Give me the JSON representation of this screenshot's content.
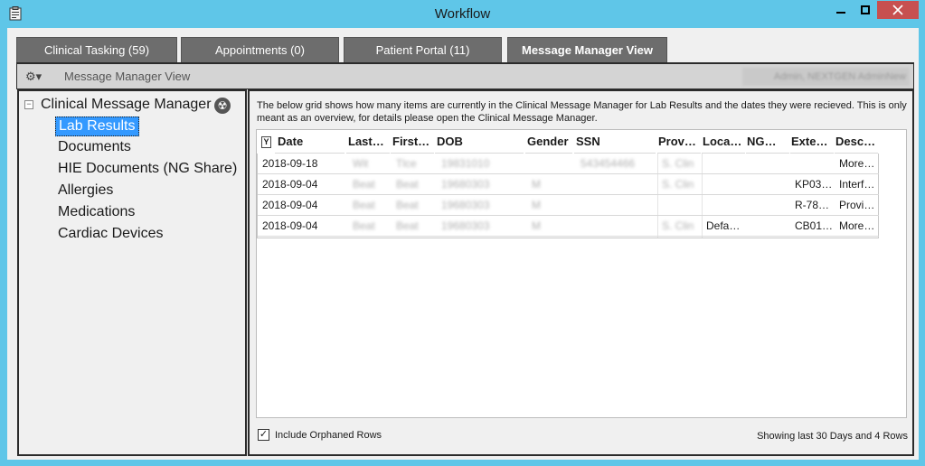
{
  "window": {
    "title": "Workflow",
    "app_icon": "clipboard-app-icon",
    "controls": {
      "minimize": "—",
      "maximize": "☐",
      "close": "✕"
    }
  },
  "tabs": [
    {
      "label": "Clinical Tasking (59)",
      "active": false
    },
    {
      "label": "Appointments (0)",
      "active": false
    },
    {
      "label": "Patient Portal (11)",
      "active": false
    },
    {
      "label": "Message Manager View",
      "active": true
    }
  ],
  "toolbar": {
    "gear_icon": "⚙▾",
    "title": "Message Manager View",
    "user": "Admin, NEXTGEN AdminNew"
  },
  "tree": {
    "root_label": "Clinical Message Manager",
    "expander": "−",
    "root_icon": "☢",
    "items": [
      {
        "label": "Lab Results",
        "selected": true
      },
      {
        "label": "Documents",
        "selected": false
      },
      {
        "label": "HIE Documents (NG Share)",
        "selected": false
      },
      {
        "label": "Allergies",
        "selected": false
      },
      {
        "label": "Medications",
        "selected": false
      },
      {
        "label": "Cardiac Devices",
        "selected": false
      }
    ]
  },
  "main": {
    "description": "The below grid shows how many items are currently in the Clinical Message Manager for Lab Results and the dates they were recieved.  This is only meant as an overview, for details please open the Clinical Message Manager.",
    "filter_icon": "Y",
    "columns": [
      "Date",
      "Last…",
      "First…",
      "DOB",
      "Gender",
      "SSN",
      "Prov…",
      "Loca…",
      "NG…",
      "Exte…",
      "Desc…"
    ],
    "rows": [
      [
        "2018-09-18",
        "Wit",
        "Tlce",
        "19831010",
        "",
        "543454466",
        "S. Clin",
        "",
        "",
        "",
        "More…"
      ],
      [
        "2018-09-04",
        "Beat",
        "Beat",
        "19680303",
        "M",
        "",
        "S. Clin",
        "",
        "",
        "KP03…",
        "Interf…"
      ],
      [
        "2018-09-04",
        "Beat",
        "Beat",
        "19680303",
        "M",
        "",
        "",
        "",
        "",
        "R-78…",
        "Provi…"
      ],
      [
        "2018-09-04",
        "Beat",
        "Beat",
        "19680303",
        "M",
        "",
        "S. Clin",
        "Defa…",
        "",
        "CB01…",
        "More…"
      ]
    ],
    "include_orphaned_label": "Include Orphaned Rows",
    "include_orphaned_checked": "✓",
    "status": "Showing last 30 Days and 4 Rows"
  }
}
